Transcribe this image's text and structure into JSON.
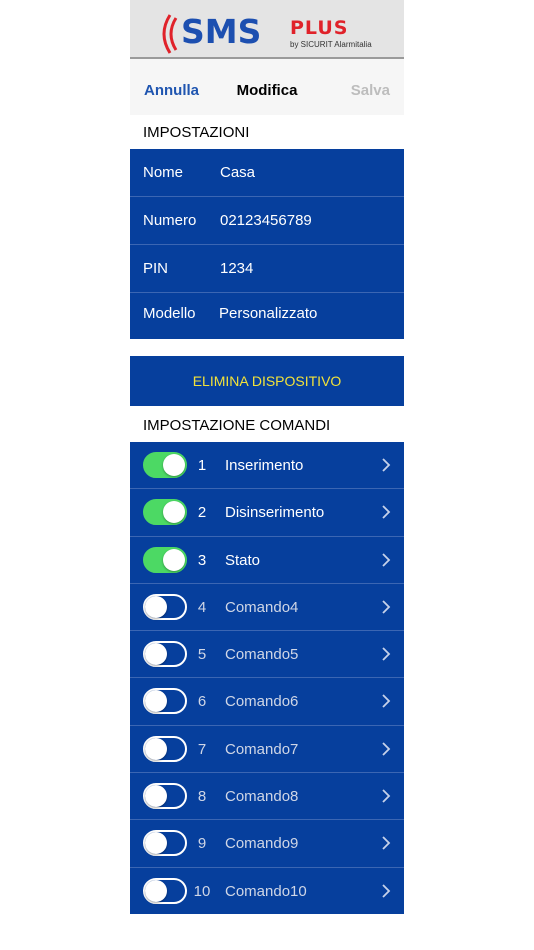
{
  "logo": {
    "brand": "SMS",
    "plus": "PLUS",
    "byline": "by SICURIT Alarmitalia"
  },
  "nav": {
    "cancel": "Annulla",
    "title": "Modifica",
    "save": "Salva"
  },
  "settings": {
    "header": "IMPOSTAZIONI",
    "fields": [
      {
        "label": "Nome",
        "value": "Casa"
      },
      {
        "label": "Numero",
        "value": "02123456789"
      },
      {
        "label": "PIN",
        "value": "1234"
      },
      {
        "label": "Modello",
        "value": "Personalizzato"
      }
    ]
  },
  "delete_button": "ELIMINA DISPOSITIVO",
  "commands": {
    "header": "IMPOSTAZIONE COMANDI",
    "items": [
      {
        "num": "1",
        "name": "Inserimento",
        "enabled": true
      },
      {
        "num": "2",
        "name": "Disinserimento",
        "enabled": true
      },
      {
        "num": "3",
        "name": "Stato",
        "enabled": true
      },
      {
        "num": "4",
        "name": "Comando4",
        "enabled": false
      },
      {
        "num": "5",
        "name": "Comando5",
        "enabled": false
      },
      {
        "num": "6",
        "name": "Comando6",
        "enabled": false
      },
      {
        "num": "7",
        "name": "Comando7",
        "enabled": false
      },
      {
        "num": "8",
        "name": "Comando8",
        "enabled": false
      },
      {
        "num": "9",
        "name": "Comando9",
        "enabled": false
      },
      {
        "num": "10",
        "name": "Comando10",
        "enabled": false
      }
    ]
  },
  "colors": {
    "accent_blue": "#063f9d",
    "nav_link": "#1f55b0",
    "toggle_on": "#4cd964",
    "delete_text": "#f2e23a",
    "logo_red": "#e0222a"
  }
}
